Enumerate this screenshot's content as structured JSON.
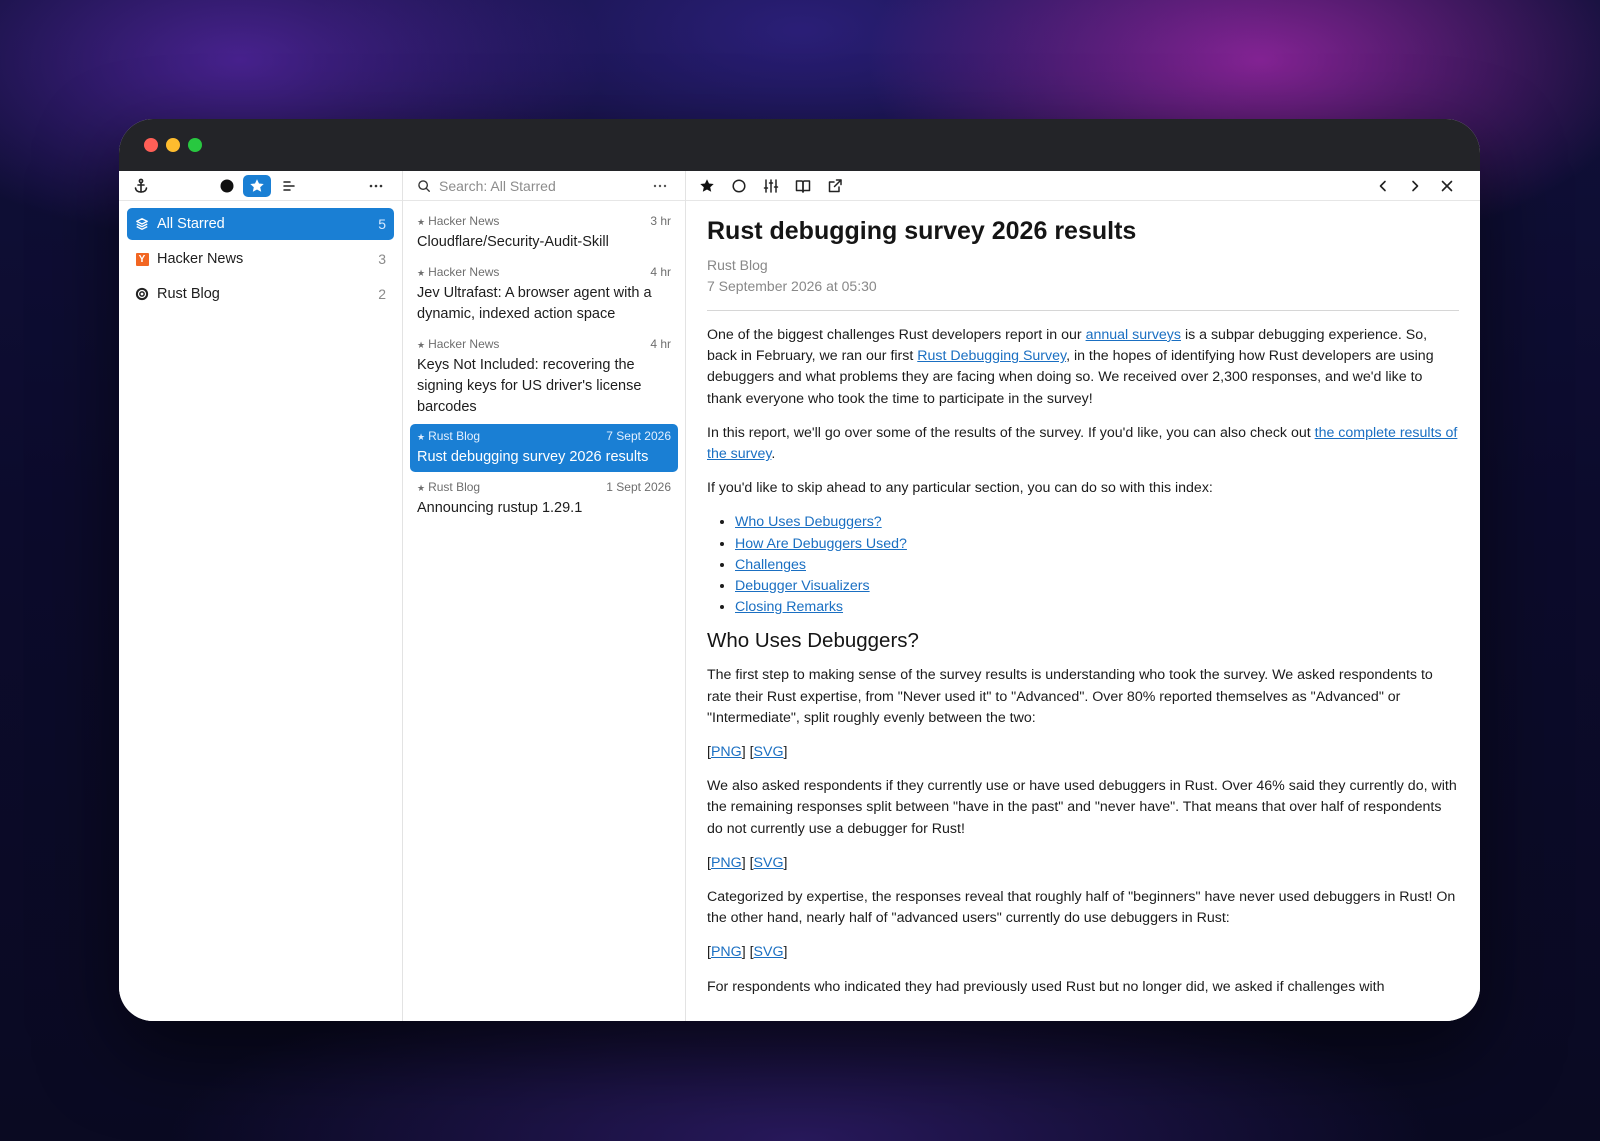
{
  "window": {
    "title": ""
  },
  "sidebar": {
    "items": [
      {
        "label": "All Starred",
        "count": "5",
        "icon": "layers-icon",
        "active": true
      },
      {
        "label": "Hacker News",
        "count": "3",
        "icon": "hacker-news-icon",
        "active": false
      },
      {
        "label": "Rust Blog",
        "count": "2",
        "icon": "rust-icon",
        "active": false
      }
    ]
  },
  "list": {
    "search_placeholder": "Search: All Starred",
    "articles": [
      {
        "source": "Hacker News",
        "time": "3 hr",
        "title": "Cloudflare/Security-Audit-Skill"
      },
      {
        "source": "Hacker News",
        "time": "4 hr",
        "title": "Jev Ultrafast: A browser agent with a dynamic, indexed action space"
      },
      {
        "source": "Hacker News",
        "time": "4 hr",
        "title": "Keys Not Included: recovering the signing keys for US driver's license barcodes"
      },
      {
        "source": "Rust Blog",
        "time": "7 Sept 2026",
        "title": "Rust debugging survey 2026 results"
      },
      {
        "source": "Rust Blog",
        "time": "1 Sept 2026",
        "title": "Announcing rustup 1.29.1"
      }
    ]
  },
  "article": {
    "title": "Rust debugging survey 2026 results",
    "source": "Rust Blog",
    "date": "7 September 2026 at 05:30",
    "p1_a": "One of the biggest challenges Rust developers report in our ",
    "p1_link1": "annual surveys",
    "p1_b": " is a subpar debugging experience. So, back in February, we ran our first ",
    "p1_link2": "Rust Debugging Survey",
    "p1_c": ", in the hopes of identifying how Rust developers are using debuggers and what problems they are facing when doing so. We received over 2,300 responses, and we'd like to thank everyone who took the time to participate in the survey!",
    "p2_a": "In this report, we'll go over some of the results of the survey. If you'd like, you can also check out ",
    "p2_link": "the complete results of the survey",
    "p2_b": ".",
    "p3": "If you'd like to skip ahead to any particular section, you can do so with this index:",
    "index": [
      "Who Uses Debuggers?",
      "How Are Debuggers Used?",
      "Challenges",
      "Debugger Visualizers",
      "Closing Remarks"
    ],
    "h2": "Who Uses Debuggers?",
    "p4": "The first step to making sense of the survey results is understanding who took the survey. We asked respondents to rate their Rust expertise, from \"Never used it\" to \"Advanced\". Over 80% reported themselves as \"Advanced\" or \"Intermediate\", split roughly evenly between the two:",
    "png": "PNG",
    "svg": "SVG",
    "p5": "We also asked respondents if they currently use or have used debuggers in Rust. Over 46% said they currently do, with the remaining responses split between \"have in the past\" and \"never have\". That means that over half of respondents do not currently use a debugger for Rust!",
    "p6": "Categorized by expertise, the responses reveal that roughly half of \"beginners\" have never used debuggers in Rust! On the other hand, nearly half of \"advanced users\" currently do use debuggers in Rust:",
    "p7": "For respondents who indicated they had previously used Rust but no longer did, we asked if challenges with"
  },
  "colors": {
    "accent": "#1a7fd4",
    "link": "#1a6fc2",
    "titlebar": "#232428"
  }
}
